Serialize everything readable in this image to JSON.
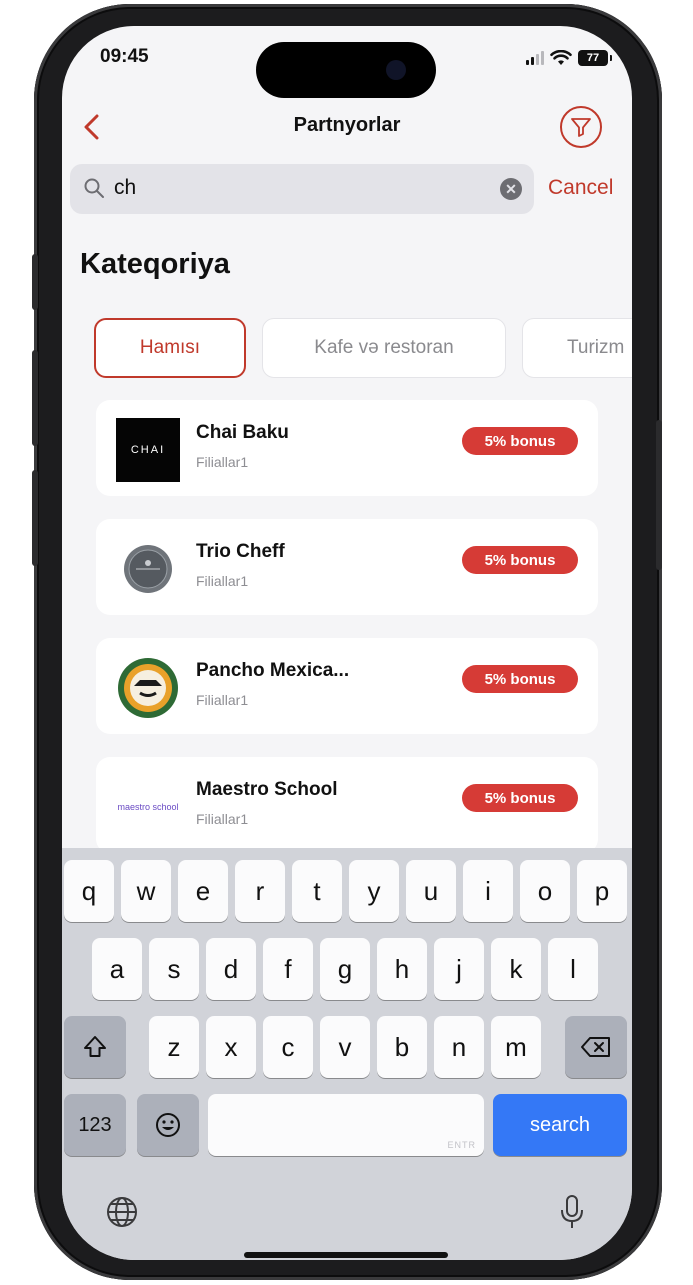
{
  "status": {
    "time": "09:45",
    "battery": "77"
  },
  "nav": {
    "title": "Partnyorlar"
  },
  "search": {
    "value": "ch",
    "cancel_label": "Cancel"
  },
  "category_heading": "Kateqoriya",
  "categories": [
    {
      "label": "Hamısı",
      "active": true
    },
    {
      "label": "Kafe və restoran",
      "active": false
    },
    {
      "label": "Turizm",
      "active": false
    }
  ],
  "partners": [
    {
      "name": "Chai Baku",
      "subtitle": "Filiallar1",
      "bonus": "5% bonus",
      "logo_text": "CHAI"
    },
    {
      "name": "Trio Cheff",
      "subtitle": "Filiallar1",
      "bonus": "5% bonus",
      "logo_text": ""
    },
    {
      "name": "Pancho Mexica...",
      "subtitle": "Filiallar1",
      "bonus": "5% bonus",
      "logo_text": ""
    },
    {
      "name": "Maestro School",
      "subtitle": "Filiallar1",
      "bonus": "5% bonus",
      "logo_text": "maestro school"
    }
  ],
  "keyboard": {
    "row1": [
      "q",
      "w",
      "e",
      "r",
      "t",
      "y",
      "u",
      "i",
      "o",
      "p"
    ],
    "row2": [
      "a",
      "s",
      "d",
      "f",
      "g",
      "h",
      "j",
      "k",
      "l"
    ],
    "row3": [
      "z",
      "x",
      "c",
      "v",
      "b",
      "n",
      "m"
    ],
    "numbers_label": "123",
    "space_hint": "ENTR",
    "search_label": "search"
  },
  "colors": {
    "accent": "#c0392b",
    "badge": "#d63b36",
    "search_key": "#3478f6"
  },
  "icons": {
    "back": "chevron-left-icon",
    "filter": "filter-icon",
    "search": "search-icon",
    "clear": "clear-icon",
    "shift": "shift-icon",
    "backspace": "backspace-icon",
    "emoji": "emoji-icon",
    "globe": "globe-icon",
    "mic": "mic-icon"
  }
}
